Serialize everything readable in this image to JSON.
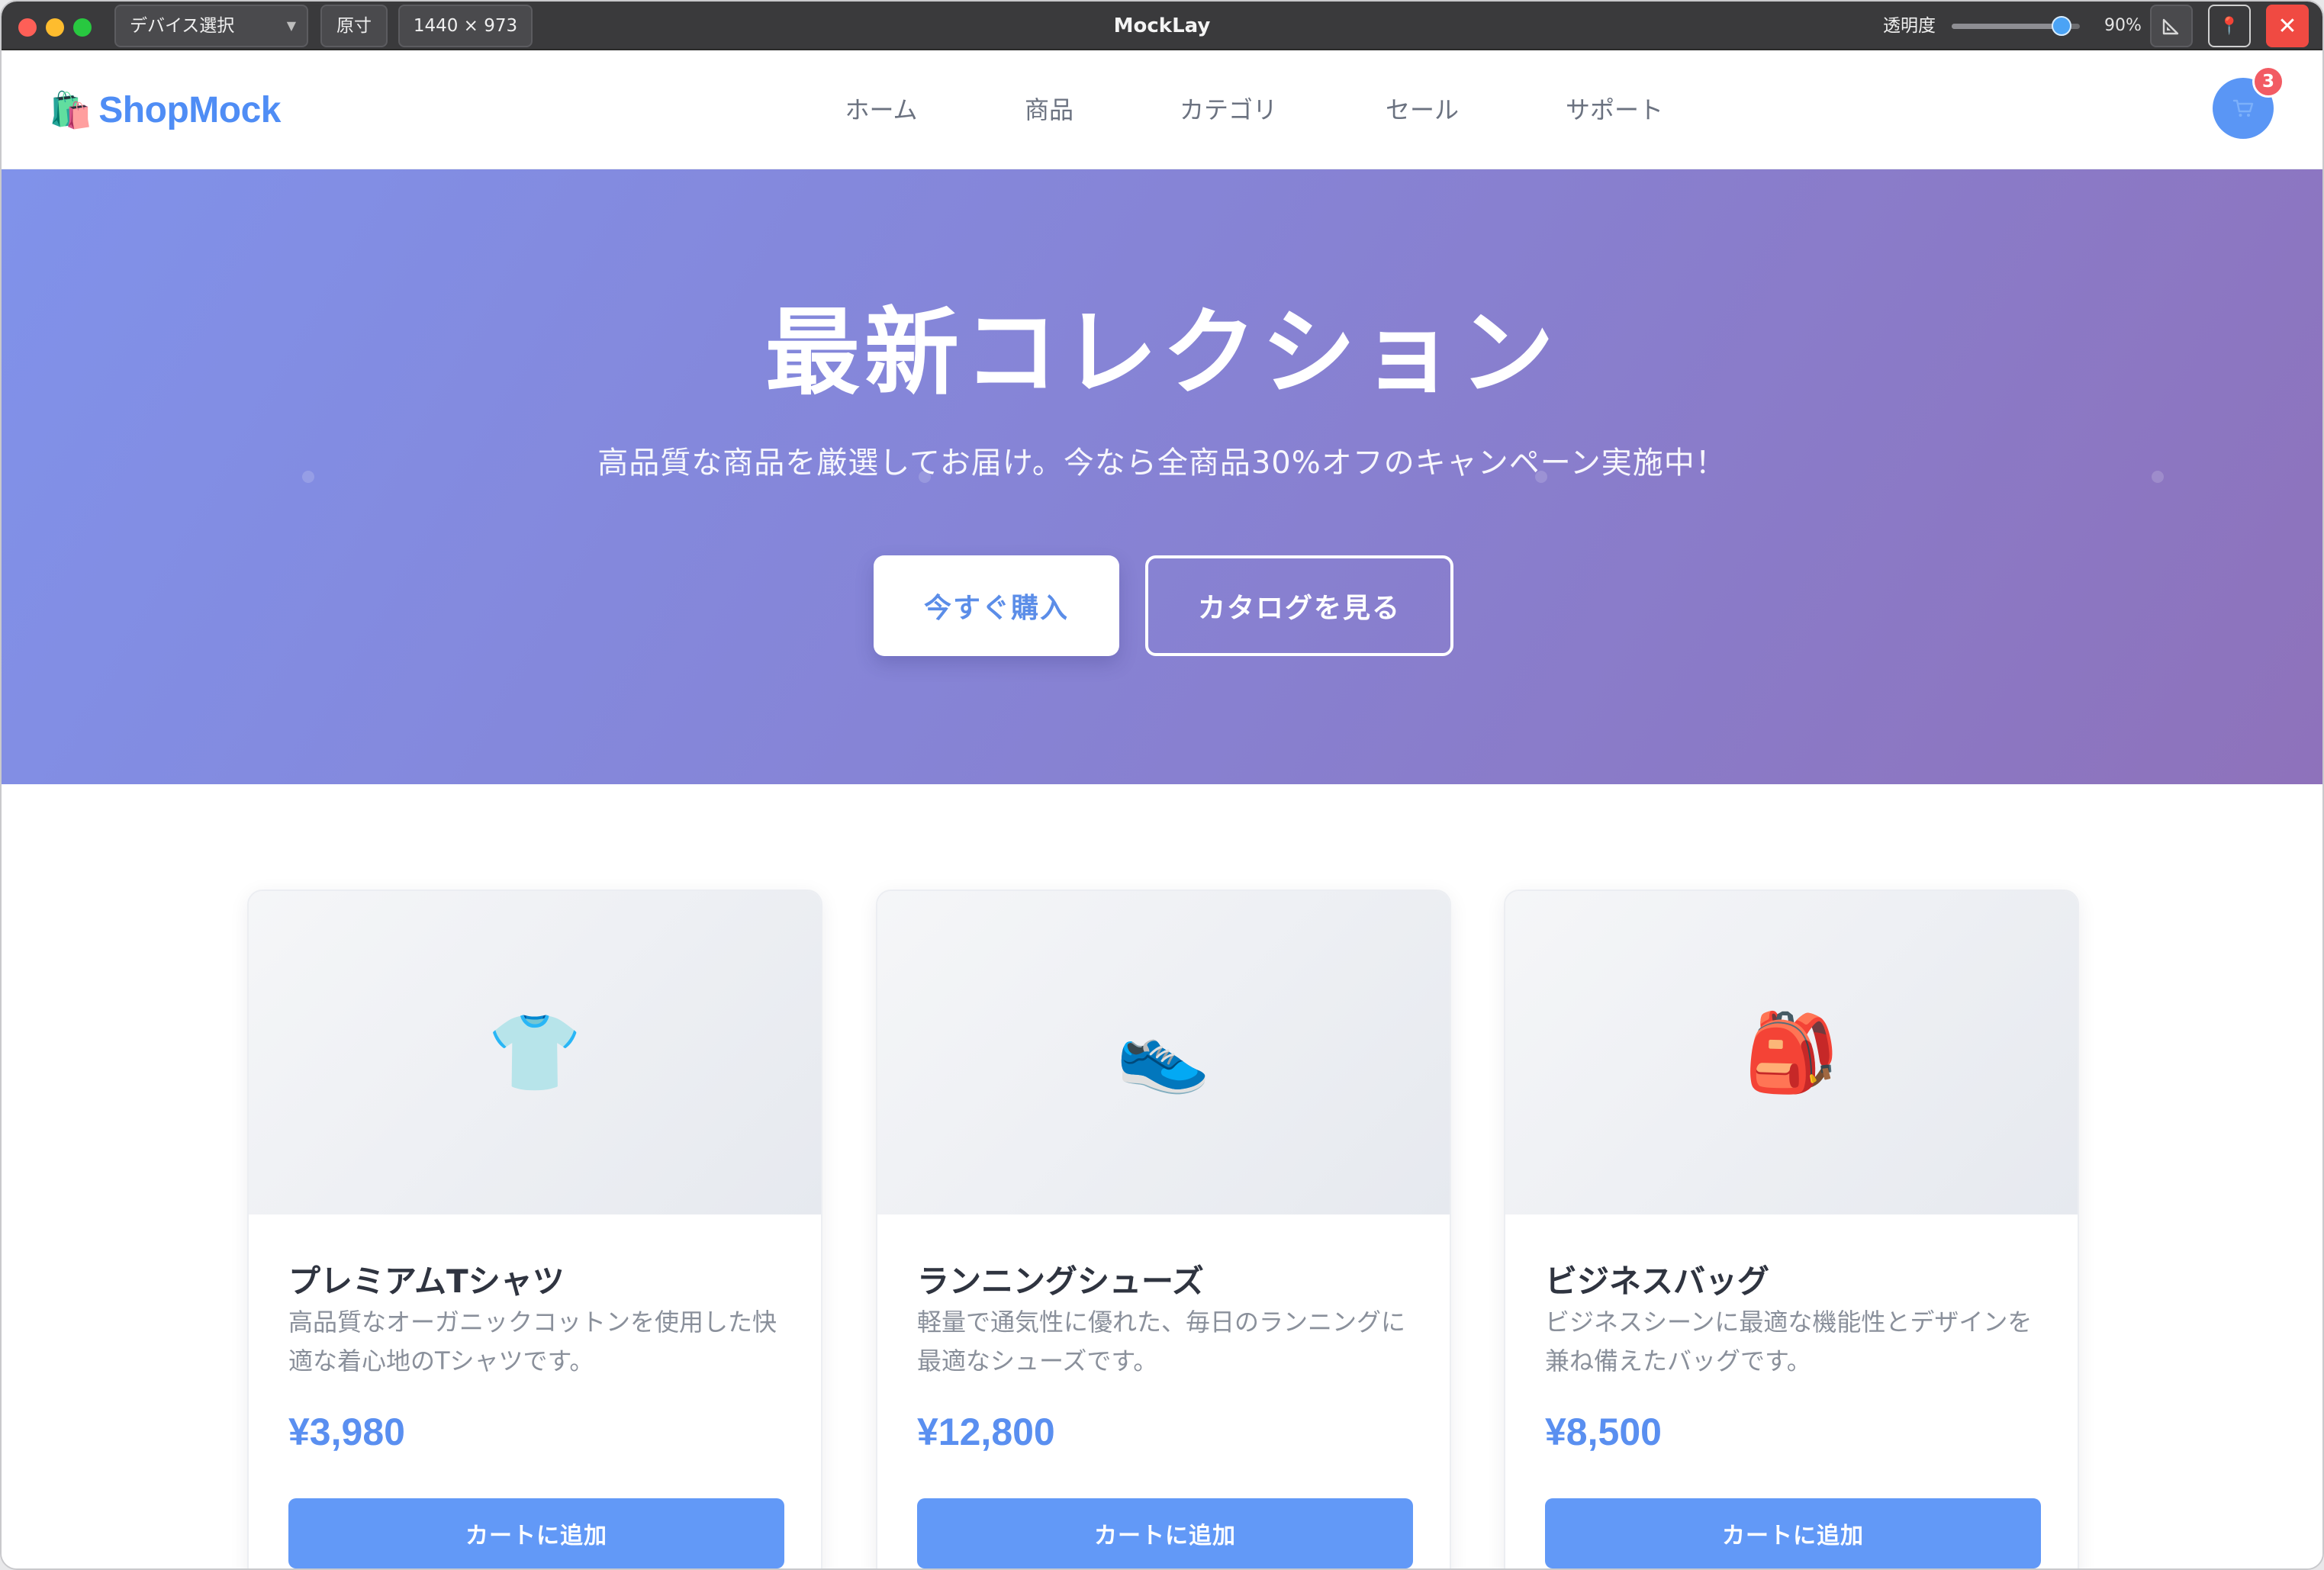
{
  "titlebar": {
    "device_select": "デバイス選択",
    "original_size": "原寸",
    "viewport": "1440 × 973",
    "app_name": "MockLay",
    "opacity_label": "透明度",
    "opacity_value": "90%",
    "opacity_level": 0.86,
    "icons": {
      "ruler": "ruler-icon",
      "pin": "pin-icon",
      "close": "close-icon"
    }
  },
  "site": {
    "logo_icon": "🛍️",
    "logo_text": "ShopMock",
    "nav": [
      "ホーム",
      "商品",
      "カテゴリ",
      "セール",
      "サポート"
    ],
    "cart_icon": "cart-icon",
    "cart_count": "3"
  },
  "hero": {
    "title": "最新コレクション",
    "subtitle": "高品質な商品を厳選してお届け。今なら全商品30%オフのキャンペーン実施中！",
    "primary_button": "今すぐ購入",
    "secondary_button": "カタログを見る"
  },
  "products": [
    {
      "icon": "👕",
      "name": "プレミアムTシャツ",
      "description": "高品質なオーガニックコットンを使用した快適な着心地のTシャツです。",
      "price": "¥3,980",
      "button": "カートに追加"
    },
    {
      "icon": "👟",
      "name": "ランニングシューズ",
      "description": "軽量で通気性に優れた、毎日のランニングに最適なシューズです。",
      "price": "¥12,800",
      "button": "カートに追加"
    },
    {
      "icon": "🎒",
      "name": "ビジネスバッグ",
      "description": "ビジネスシーンに最適な機能性とデザインを兼ね備えたバッグです。",
      "price": "¥8,500",
      "button": "カートに追加"
    }
  ],
  "colors": {
    "brand": "#4f8df5",
    "hero_gradient_start": "#8092ea",
    "hero_gradient_end": "#8e72bb",
    "price": "#5a8ff0",
    "button": "#6299f7",
    "badge": "#f25b63"
  }
}
